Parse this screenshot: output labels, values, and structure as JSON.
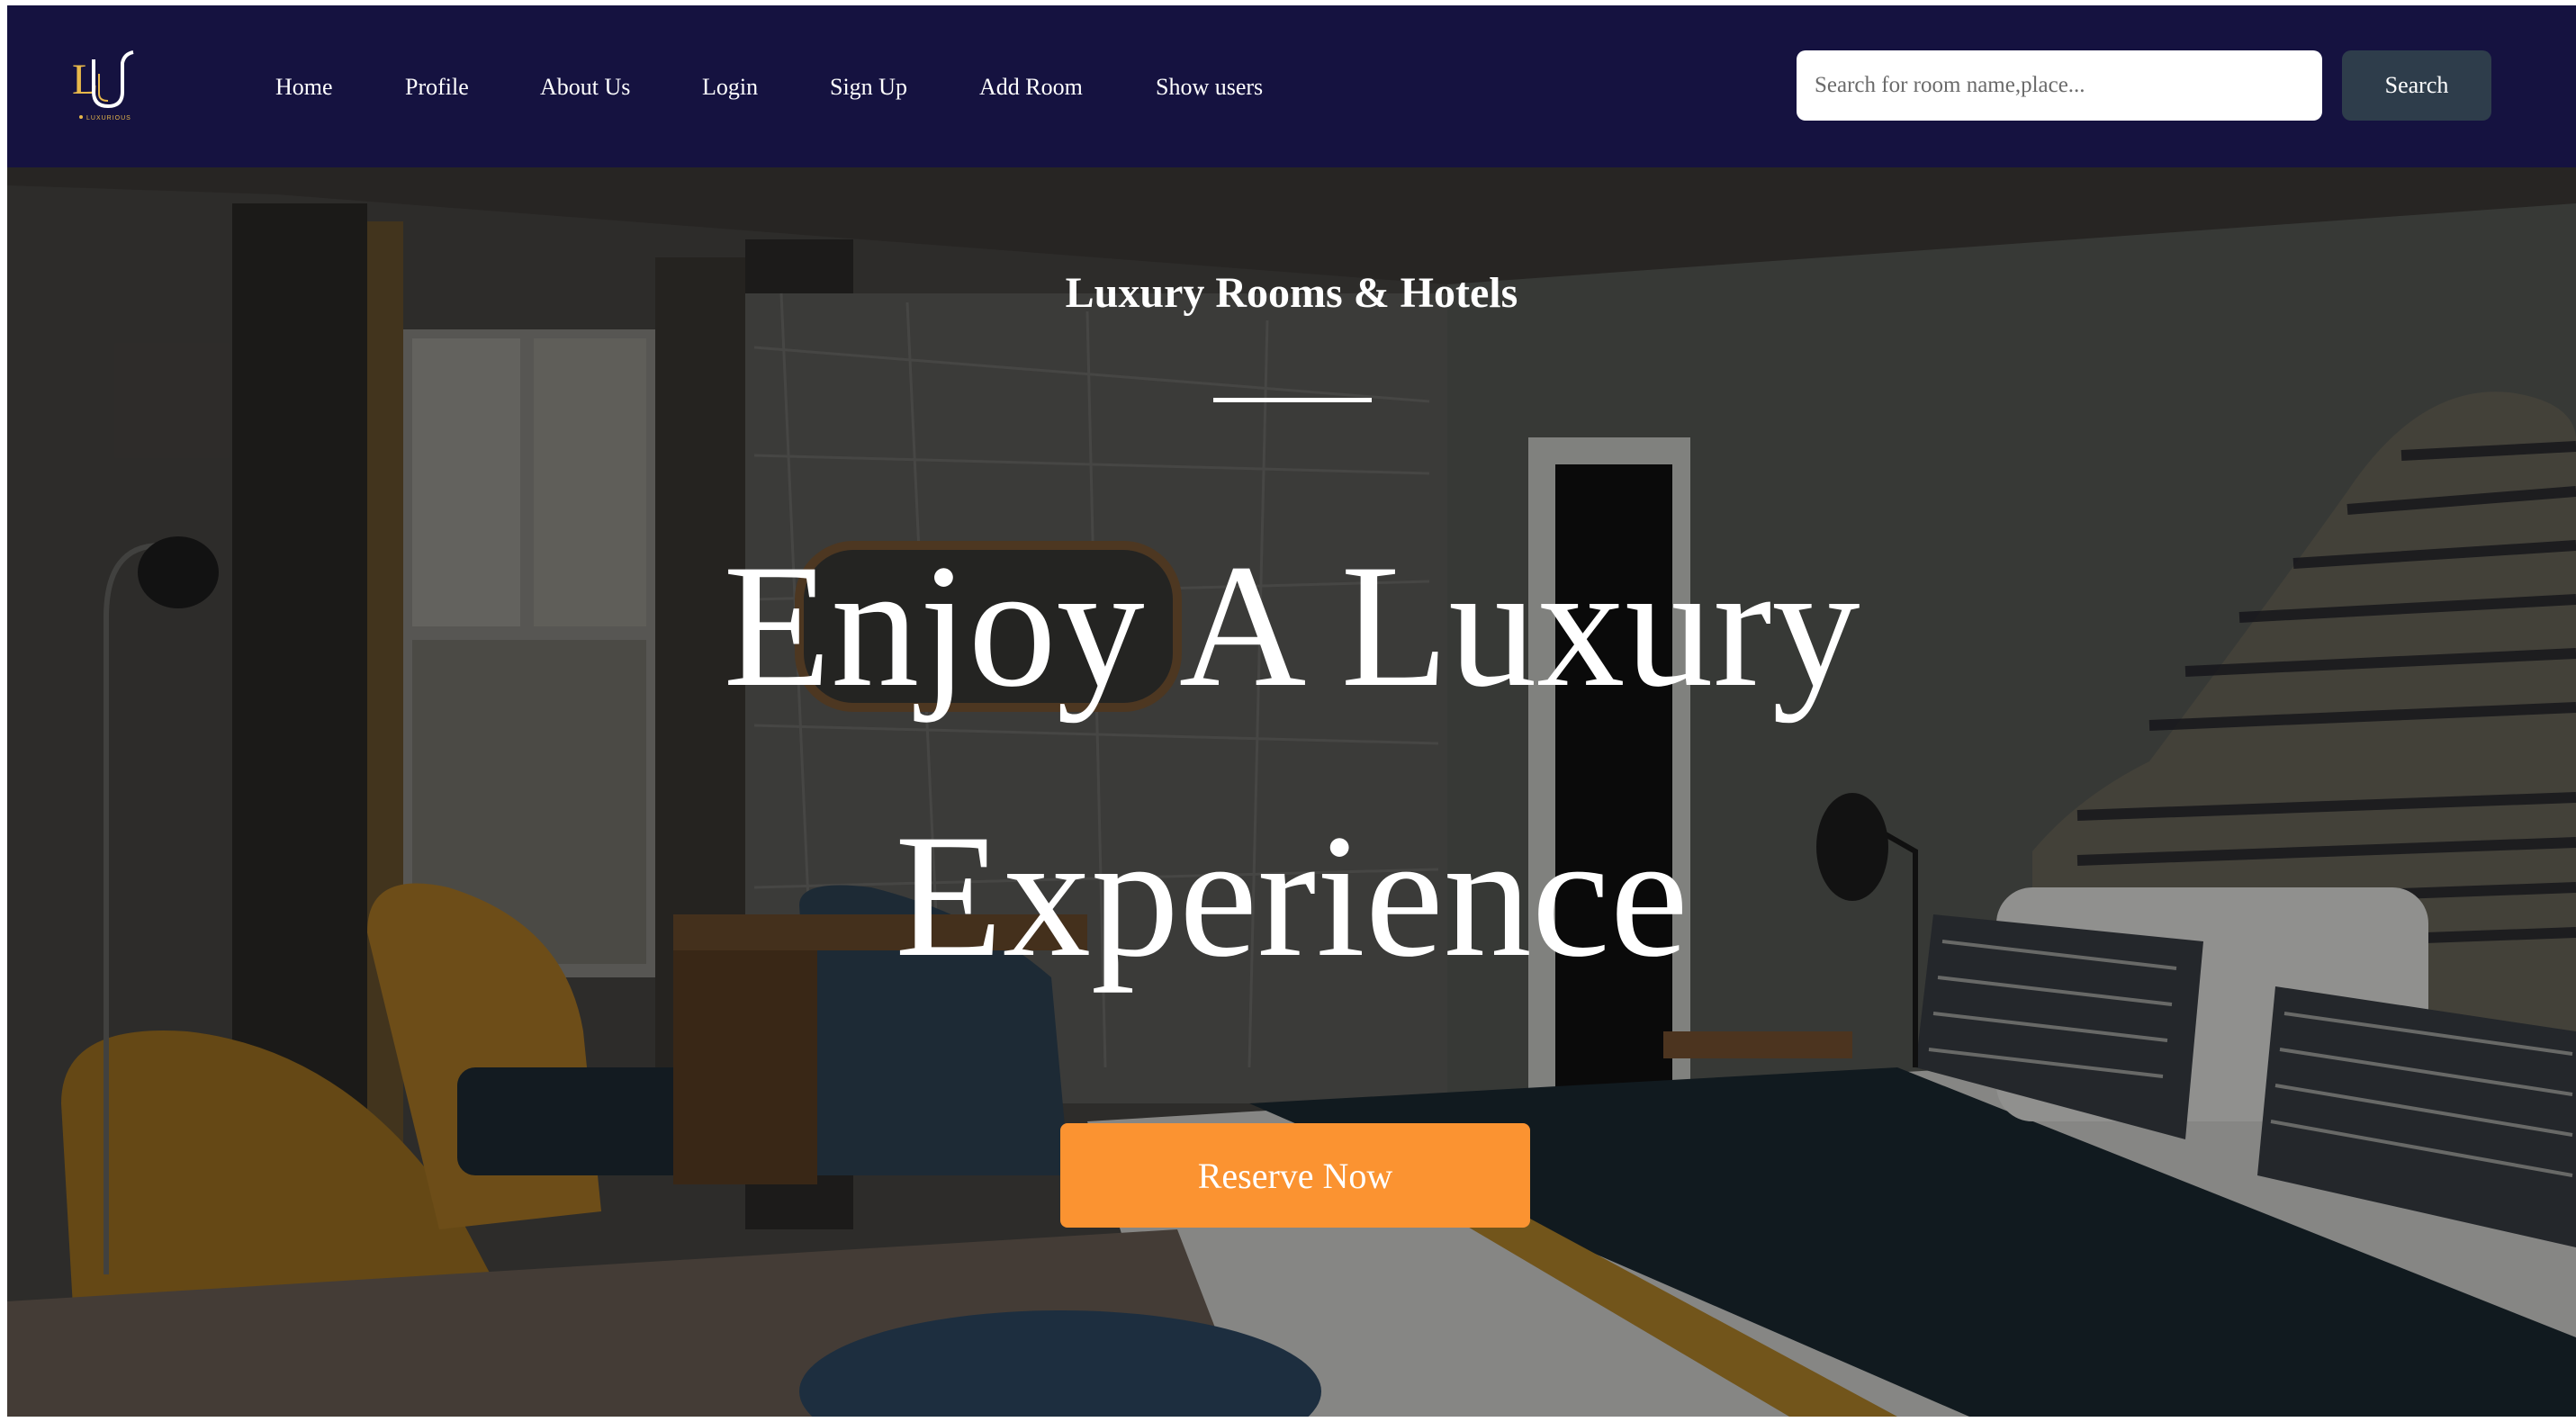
{
  "brand": {
    "logo_letters": "LU",
    "logo_tagline": "LUXURIOUS",
    "accent_color": "#e8b84a"
  },
  "nav": {
    "background": "#151240",
    "items": [
      {
        "label": "Home"
      },
      {
        "label": "Profile"
      },
      {
        "label": "About Us"
      },
      {
        "label": "Login"
      },
      {
        "label": "Sign Up"
      },
      {
        "label": "Add Room"
      },
      {
        "label": "Show users"
      }
    ]
  },
  "search": {
    "placeholder": "Search for room name,place...",
    "value": "",
    "button_label": "Search",
    "icon": "search-icon"
  },
  "hero": {
    "subtitle": "Luxury Rooms & Hotels",
    "title_line1": "Enjoy A Luxury",
    "title_line2": "Experience",
    "cta_label": "Reserve Now",
    "cta_color": "#fb9331",
    "background_image": "hotel bedroom interior"
  }
}
